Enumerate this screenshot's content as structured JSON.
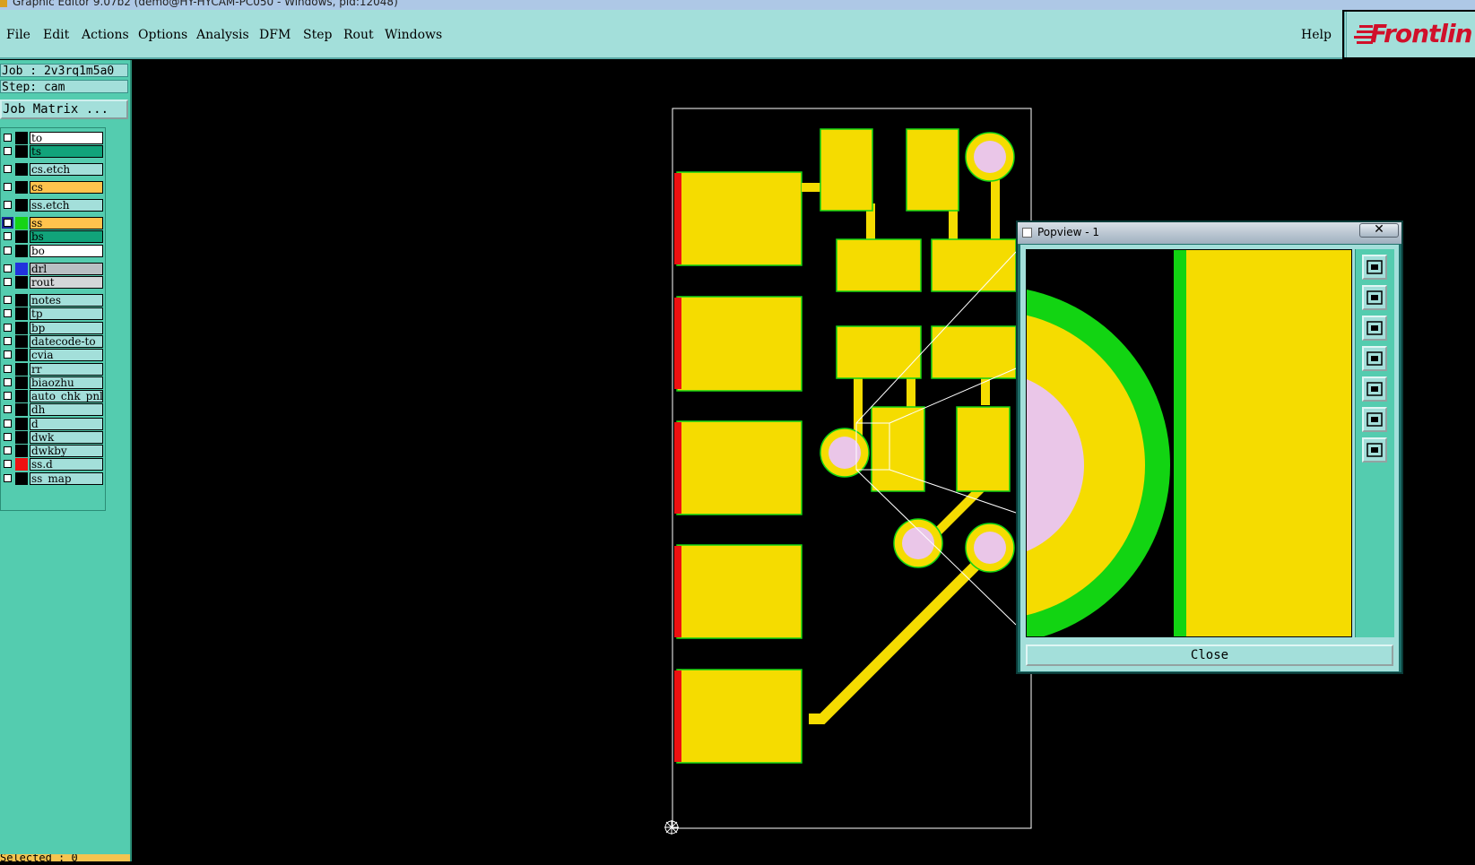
{
  "window_title": "Graphic Editor 9.07b2 (demo@HY-HYCAM-PC050 - Windows, pid:12048)",
  "menu": {
    "items": [
      {
        "label": "File"
      },
      {
        "label": "Edit"
      },
      {
        "label": "Actions"
      },
      {
        "label": "Options"
      },
      {
        "label": "Analysis"
      },
      {
        "label": "DFM"
      },
      {
        "label": "Step"
      },
      {
        "label": "Rout"
      },
      {
        "label": "Windows"
      }
    ],
    "help": "Help"
  },
  "brand": "Frontlin",
  "job": {
    "job_label": "Job : 2v3rq1m5a0",
    "step_label": "Step: cam",
    "matrix_button": "Job Matrix ..."
  },
  "layers": [
    {
      "name": "to",
      "swatch": "#000000",
      "bg": "#ffffff"
    },
    {
      "name": "ts",
      "swatch": "#000000",
      "bg": "#11a37a"
    },
    {
      "name": "cs.etch",
      "swatch": "#000000",
      "bg": "#a3dfda"
    },
    {
      "name": "cs",
      "swatch": "#000000",
      "bg": "#ffc34d"
    },
    {
      "name": "ss.etch",
      "swatch": "#000000",
      "bg": "#a3dfda"
    },
    {
      "name": "ss",
      "swatch": "#16d416",
      "bg": "#ffc34d",
      "active": true
    },
    {
      "name": "bs",
      "swatch": "#000000",
      "bg": "#11a37a"
    },
    {
      "name": "bo",
      "swatch": "#000000",
      "bg": "#ffffff"
    },
    {
      "name": "drl",
      "swatch": "#2233dd",
      "bg": "#b9bfc3"
    },
    {
      "name": "rout",
      "swatch": "#000000",
      "bg": "#d3d6d8"
    },
    {
      "name": "notes",
      "swatch": "#000000",
      "bg": "#a3dfda"
    },
    {
      "name": "tp",
      "swatch": "#000000",
      "bg": "#a3dfda"
    },
    {
      "name": "bp",
      "swatch": "#000000",
      "bg": "#a3dfda"
    },
    {
      "name": "datecode-to",
      "swatch": "#000000",
      "bg": "#a3dfda"
    },
    {
      "name": "cvia",
      "swatch": "#000000",
      "bg": "#a3dfda"
    },
    {
      "name": "rr",
      "swatch": "#000000",
      "bg": "#a3dfda"
    },
    {
      "name": "biaozhu",
      "swatch": "#000000",
      "bg": "#a3dfda"
    },
    {
      "name": "auto_chk_pnl",
      "swatch": "#000000",
      "bg": "#a3dfda"
    },
    {
      "name": "dh",
      "swatch": "#000000",
      "bg": "#a3dfda"
    },
    {
      "name": "d",
      "swatch": "#000000",
      "bg": "#a3dfda"
    },
    {
      "name": "dwk",
      "swatch": "#000000",
      "bg": "#a3dfda"
    },
    {
      "name": "dwkby",
      "swatch": "#000000",
      "bg": "#a3dfda"
    },
    {
      "name": "ss.d",
      "swatch": "#ee1111",
      "bg": "#a3dfda"
    },
    {
      "name": "ss_map",
      "swatch": "#000000",
      "bg": "#a3dfda"
    }
  ],
  "selected_label": "Selected : 0",
  "popview": {
    "title": "Popview - 1",
    "close_icon": "✕",
    "close_button": "Close",
    "tools": [
      "zoom-window-icon",
      "pan-up-icon",
      "pan-down-icon",
      "pan-left-icon",
      "pan-right-icon",
      "zoom-in-icon",
      "zoom-out-icon"
    ]
  },
  "colors": {
    "copper": "#f5dc00",
    "clearance": "#12d412",
    "drill": "#eac6e8",
    "edge_marker": "#ee1111",
    "panel": "#54ccaf",
    "menu": "#a3dfda"
  }
}
